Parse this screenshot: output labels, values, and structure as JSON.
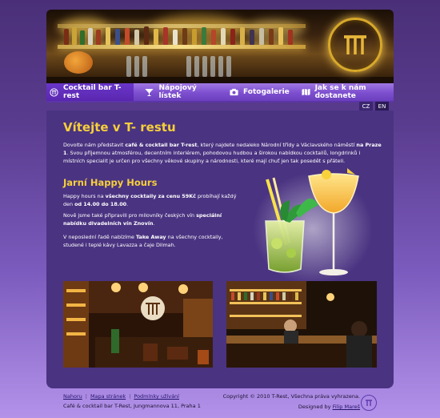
{
  "nav": {
    "items": [
      {
        "label": "Cocktail bar T-rest",
        "icon": "t-logo-icon"
      },
      {
        "label": "Nápojový lístek",
        "icon": "cocktail-glass-icon"
      },
      {
        "label": "Fotogalerie",
        "icon": "camera-icon"
      },
      {
        "label": "Jak se k nám dostanete",
        "icon": "map-icon"
      }
    ]
  },
  "lang": {
    "cz": "CZ",
    "en": "EN"
  },
  "content": {
    "title": "Vítejte v T- restu",
    "intro": {
      "p1": "Dovolte nám představit ",
      "b1": "café & cocktail bar T-rest",
      "p2": ", který najdete nedaleko Národní třídy a Václavského náměstí ",
      "b2": "na Praze 1",
      "p3": ". Svou příjemnou atmosférou, decentním interiérem, pohodovou hudbou a širokou nabídkou cocktailů, longdrinků i místních specialit je určen pro všechny věkové skupiny a národnosti, které mají chuť jen tak posedět s přáteli."
    },
    "happy_title": "Jarní Happy Hours",
    "hp1": {
      "a": "Happy hours na ",
      "b": "všechny cocktaily za cenu 59Kč",
      "c": " probíhají každý den ",
      "d": "od 14.00 do 18.00",
      "e": "."
    },
    "hp2": {
      "a": "Nově jsme také připravili pro milovníky českých vín ",
      "b": "speciální nabídku divadelních vín Znovín",
      "c": "."
    },
    "hp3": {
      "a": "V neposlední řadě nabízíme ",
      "b": "Take Away",
      "c": " na všechny cocktaily, studené i teplé kávy Lavazza a čaje Dilmah."
    }
  },
  "footer": {
    "links": [
      "Nahoru",
      "Mapa stránek",
      "Podmínky užívání"
    ],
    "address": "Café & cocktail bar T-Rest, Jungmannova 11, Praha 1",
    "copyright": "Copyright © 2010 T-Rest, Všechna práva vyhrazena.",
    "designed_prefix": "Designed by ",
    "designer": "Filip Mareš"
  },
  "colors": {
    "accent_yellow": "#f6cf3a",
    "nav_purple": "#7d4fcf",
    "content_bg": "#4a3381"
  }
}
